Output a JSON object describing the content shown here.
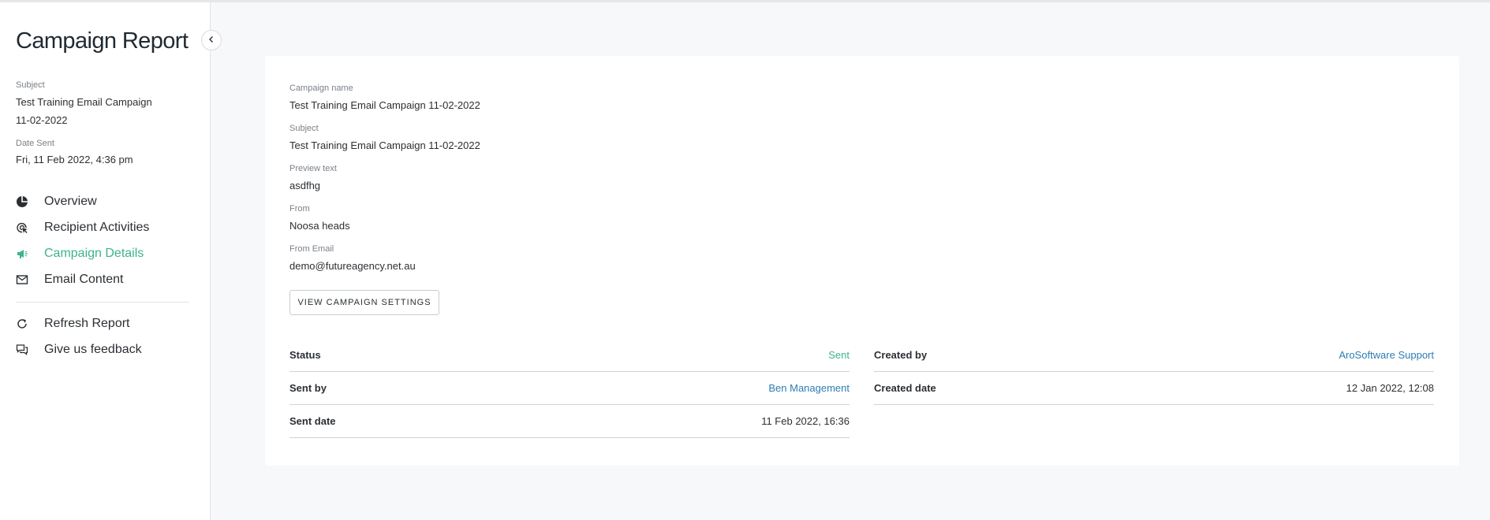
{
  "sidebar": {
    "title": "Campaign Report",
    "subject_label": "Subject",
    "subject_line1": "Test Training Email Campaign",
    "subject_line2": "11-02-2022",
    "date_label": "Date Sent",
    "date_value": "Fri, 11 Feb 2022, 4:36 pm",
    "nav": [
      {
        "label": "Overview",
        "icon": "pie-chart-icon"
      },
      {
        "label": "Recipient Activities",
        "icon": "cursor-click-icon"
      },
      {
        "label": "Campaign Details",
        "icon": "megaphone-icon",
        "active": true
      },
      {
        "label": "Email Content",
        "icon": "envelope-icon"
      }
    ],
    "actions": [
      {
        "label": "Refresh Report",
        "icon": "refresh-icon"
      },
      {
        "label": "Give us feedback",
        "icon": "chat-bubbles-icon"
      }
    ]
  },
  "details": {
    "campaign_name_label": "Campaign name",
    "campaign_name": "Test Training Email Campaign 11-02-2022",
    "subject_label": "Subject",
    "subject": "Test Training Email Campaign 11-02-2022",
    "preview_label": "Preview text",
    "preview": "asdfhg",
    "from_label": "From",
    "from": "Noosa heads",
    "from_email_label": "From Email",
    "from_email": "demo@futureagency.net.au",
    "view_settings_button": "VIEW CAMPAIGN SETTINGS"
  },
  "info_left": [
    {
      "key": "Status",
      "value": "Sent"
    },
    {
      "key": "Sent by",
      "value": "Ben Management"
    },
    {
      "key": "Sent date",
      "value": "11 Feb 2022, 16:36"
    }
  ],
  "info_right": [
    {
      "key": "Created by",
      "value": "AroSoftware Support"
    },
    {
      "key": "Created date",
      "value": "12 Jan 2022, 12:08"
    }
  ],
  "colors": {
    "accent_green": "#3fb28e",
    "link_blue": "#2d7db3"
  }
}
